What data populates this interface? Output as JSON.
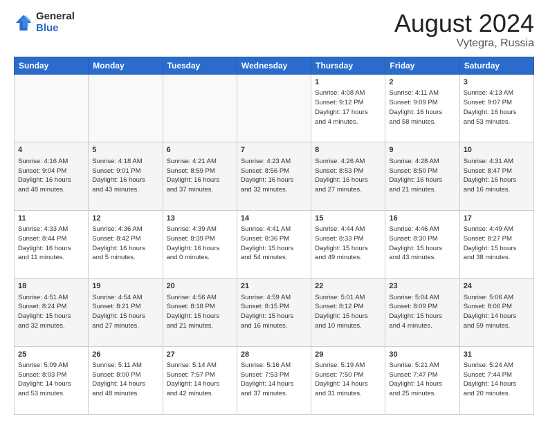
{
  "logo": {
    "general": "General",
    "blue": "Blue"
  },
  "title": {
    "month": "August 2024",
    "location": "Vytegra, Russia"
  },
  "headers": [
    "Sunday",
    "Monday",
    "Tuesday",
    "Wednesday",
    "Thursday",
    "Friday",
    "Saturday"
  ],
  "weeks": [
    [
      {
        "day": "",
        "content": ""
      },
      {
        "day": "",
        "content": ""
      },
      {
        "day": "",
        "content": ""
      },
      {
        "day": "",
        "content": ""
      },
      {
        "day": "1",
        "content": "Sunrise: 4:08 AM\nSunset: 9:12 PM\nDaylight: 17 hours\nand 4 minutes."
      },
      {
        "day": "2",
        "content": "Sunrise: 4:11 AM\nSunset: 9:09 PM\nDaylight: 16 hours\nand 58 minutes."
      },
      {
        "day": "3",
        "content": "Sunrise: 4:13 AM\nSunset: 9:07 PM\nDaylight: 16 hours\nand 53 minutes."
      }
    ],
    [
      {
        "day": "4",
        "content": "Sunrise: 4:16 AM\nSunset: 9:04 PM\nDaylight: 16 hours\nand 48 minutes."
      },
      {
        "day": "5",
        "content": "Sunrise: 4:18 AM\nSunset: 9:01 PM\nDaylight: 16 hours\nand 43 minutes."
      },
      {
        "day": "6",
        "content": "Sunrise: 4:21 AM\nSunset: 8:59 PM\nDaylight: 16 hours\nand 37 minutes."
      },
      {
        "day": "7",
        "content": "Sunrise: 4:23 AM\nSunset: 8:56 PM\nDaylight: 16 hours\nand 32 minutes."
      },
      {
        "day": "8",
        "content": "Sunrise: 4:26 AM\nSunset: 8:53 PM\nDaylight: 16 hours\nand 27 minutes."
      },
      {
        "day": "9",
        "content": "Sunrise: 4:28 AM\nSunset: 8:50 PM\nDaylight: 16 hours\nand 21 minutes."
      },
      {
        "day": "10",
        "content": "Sunrise: 4:31 AM\nSunset: 8:47 PM\nDaylight: 16 hours\nand 16 minutes."
      }
    ],
    [
      {
        "day": "11",
        "content": "Sunrise: 4:33 AM\nSunset: 8:44 PM\nDaylight: 16 hours\nand 11 minutes."
      },
      {
        "day": "12",
        "content": "Sunrise: 4:36 AM\nSunset: 8:42 PM\nDaylight: 16 hours\nand 5 minutes."
      },
      {
        "day": "13",
        "content": "Sunrise: 4:39 AM\nSunset: 8:39 PM\nDaylight: 16 hours\nand 0 minutes."
      },
      {
        "day": "14",
        "content": "Sunrise: 4:41 AM\nSunset: 8:36 PM\nDaylight: 15 hours\nand 54 minutes."
      },
      {
        "day": "15",
        "content": "Sunrise: 4:44 AM\nSunset: 8:33 PM\nDaylight: 15 hours\nand 49 minutes."
      },
      {
        "day": "16",
        "content": "Sunrise: 4:46 AM\nSunset: 8:30 PM\nDaylight: 15 hours\nand 43 minutes."
      },
      {
        "day": "17",
        "content": "Sunrise: 4:49 AM\nSunset: 8:27 PM\nDaylight: 15 hours\nand 38 minutes."
      }
    ],
    [
      {
        "day": "18",
        "content": "Sunrise: 4:51 AM\nSunset: 8:24 PM\nDaylight: 15 hours\nand 32 minutes."
      },
      {
        "day": "19",
        "content": "Sunrise: 4:54 AM\nSunset: 8:21 PM\nDaylight: 15 hours\nand 27 minutes."
      },
      {
        "day": "20",
        "content": "Sunrise: 4:56 AM\nSunset: 8:18 PM\nDaylight: 15 hours\nand 21 minutes."
      },
      {
        "day": "21",
        "content": "Sunrise: 4:59 AM\nSunset: 8:15 PM\nDaylight: 15 hours\nand 16 minutes."
      },
      {
        "day": "22",
        "content": "Sunrise: 5:01 AM\nSunset: 8:12 PM\nDaylight: 15 hours\nand 10 minutes."
      },
      {
        "day": "23",
        "content": "Sunrise: 5:04 AM\nSunset: 8:09 PM\nDaylight: 15 hours\nand 4 minutes."
      },
      {
        "day": "24",
        "content": "Sunrise: 5:06 AM\nSunset: 8:06 PM\nDaylight: 14 hours\nand 59 minutes."
      }
    ],
    [
      {
        "day": "25",
        "content": "Sunrise: 5:09 AM\nSunset: 8:03 PM\nDaylight: 14 hours\nand 53 minutes."
      },
      {
        "day": "26",
        "content": "Sunrise: 5:11 AM\nSunset: 8:00 PM\nDaylight: 14 hours\nand 48 minutes."
      },
      {
        "day": "27",
        "content": "Sunrise: 5:14 AM\nSunset: 7:57 PM\nDaylight: 14 hours\nand 42 minutes."
      },
      {
        "day": "28",
        "content": "Sunrise: 5:16 AM\nSunset: 7:53 PM\nDaylight: 14 hours\nand 37 minutes."
      },
      {
        "day": "29",
        "content": "Sunrise: 5:19 AM\nSunset: 7:50 PM\nDaylight: 14 hours\nand 31 minutes."
      },
      {
        "day": "30",
        "content": "Sunrise: 5:21 AM\nSunset: 7:47 PM\nDaylight: 14 hours\nand 25 minutes."
      },
      {
        "day": "31",
        "content": "Sunrise: 5:24 AM\nSunset: 7:44 PM\nDaylight: 14 hours\nand 20 minutes."
      }
    ]
  ]
}
